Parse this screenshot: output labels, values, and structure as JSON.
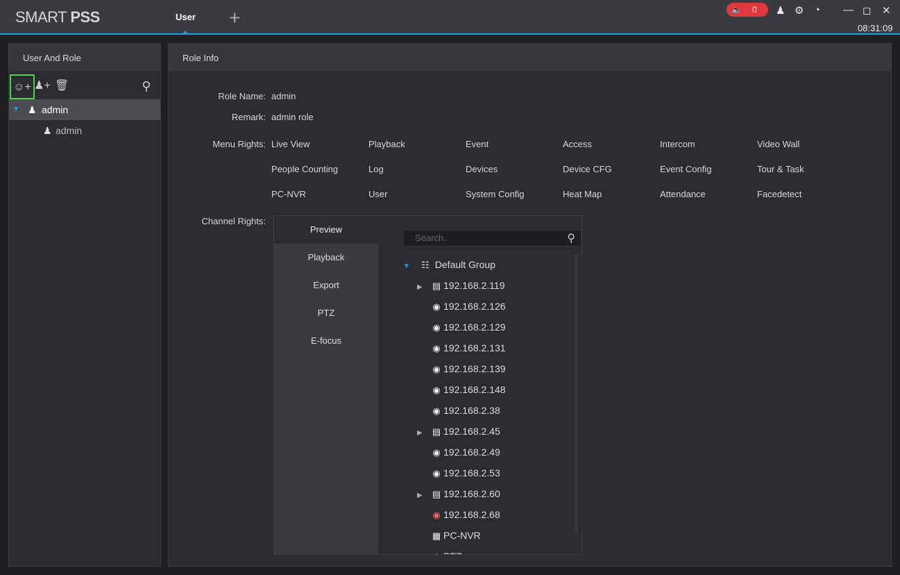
{
  "app": {
    "logo": "SMART PSS",
    "tab": "User",
    "alarm_count": "0",
    "time": "08:31:09"
  },
  "left": {
    "title": "User And Role",
    "role": "admin",
    "user": "admin"
  },
  "right": {
    "title": "Role Info",
    "role_name_label": "Role Name:",
    "role_name": "admin",
    "remark_label": "Remark:",
    "remark": "admin role",
    "menu_rights_label": "Menu Rights:",
    "menu_rights": [
      "Live View",
      "Playback",
      "Event",
      "Access",
      "Intercom",
      "Video Wall",
      "People Counting",
      "Log",
      "Devices",
      "Device CFG",
      "Event Config",
      "Tour & Task",
      "PC-NVR",
      "User",
      "System Config",
      "Heat Map",
      "Attendance",
      "Facedetect"
    ],
    "channel_rights_label": "Channel Rights:"
  },
  "channel": {
    "tabs": [
      "Preview",
      "Playback",
      "Export",
      "PTZ",
      "E-focus"
    ],
    "search_placeholder": "Search..",
    "group": "Default Group",
    "nodes": [
      {
        "label": "192.168.2.119",
        "icon": "nvr-icon",
        "expandable": true
      },
      {
        "label": "192.168.2.126",
        "icon": "camera-icon"
      },
      {
        "label": "192.168.2.129",
        "icon": "camera-icon"
      },
      {
        "label": "192.168.2.131",
        "icon": "camera-icon"
      },
      {
        "label": "192.168.2.139",
        "icon": "camera-icon"
      },
      {
        "label": "192.168.2.148",
        "icon": "camera-icon"
      },
      {
        "label": "192.168.2.38",
        "icon": "camera-icon"
      },
      {
        "label": "192.168.2.45",
        "icon": "nvr-icon",
        "expandable": true
      },
      {
        "label": "192.168.2.49",
        "icon": "camera-icon"
      },
      {
        "label": "192.168.2.53",
        "icon": "camera-icon"
      },
      {
        "label": "192.168.2.60",
        "icon": "dvr-icon",
        "expandable": true
      },
      {
        "label": "192.168.2.68",
        "icon": "camera-offline-icon"
      },
      {
        "label": "PC-NVR",
        "icon": "pc-nvr-icon"
      },
      {
        "label": "PTZ",
        "icon": "camera-icon"
      }
    ]
  }
}
